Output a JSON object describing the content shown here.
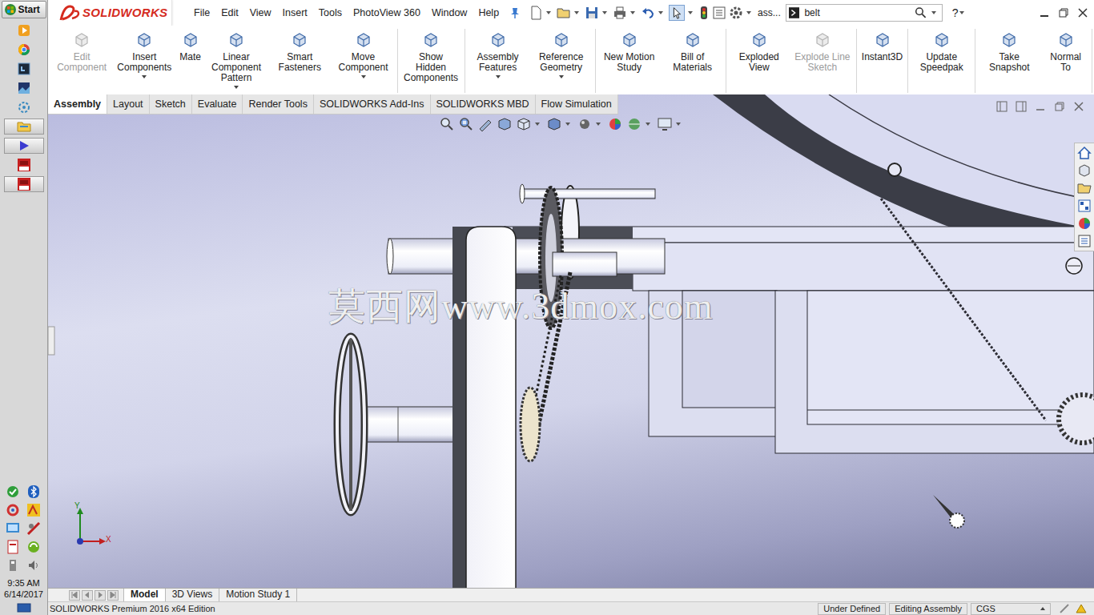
{
  "taskbar": {
    "start": "Start",
    "time": "9:35 AM",
    "date": "6/14/2017"
  },
  "app": {
    "logo": "SOLIDWORKS",
    "menus": [
      "File",
      "Edit",
      "View",
      "Insert",
      "Tools",
      "PhotoView 360",
      "Window",
      "Help"
    ],
    "document": "ass...",
    "search": {
      "value": "belt"
    },
    "help": "?"
  },
  "command_manager": {
    "groups": [
      [
        {
          "label": "Edit Component",
          "disabled": true,
          "dropdown": false
        },
        {
          "label": "Insert Components",
          "disabled": false,
          "dropdown": true
        },
        {
          "label": "Mate",
          "disabled": false,
          "dropdown": false
        },
        {
          "label": "Linear Component Pattern",
          "disabled": false,
          "dropdown": true
        },
        {
          "label": "Smart Fasteners",
          "disabled": false,
          "dropdown": false
        },
        {
          "label": "Move Component",
          "disabled": false,
          "dropdown": true
        }
      ],
      [
        {
          "label": "Show Hidden Components",
          "disabled": false,
          "dropdown": false
        }
      ],
      [
        {
          "label": "Assembly Features",
          "disabled": false,
          "dropdown": true
        },
        {
          "label": "Reference Geometry",
          "disabled": false,
          "dropdown": true
        }
      ],
      [
        {
          "label": "New Motion Study",
          "disabled": false,
          "dropdown": false
        },
        {
          "label": "Bill of Materials",
          "disabled": false,
          "dropdown": false
        }
      ],
      [
        {
          "label": "Exploded View",
          "disabled": false,
          "dropdown": false
        },
        {
          "label": "Explode Line Sketch",
          "disabled": true,
          "dropdown": false
        }
      ],
      [
        {
          "label": "Instant3D",
          "disabled": false,
          "dropdown": false
        }
      ],
      [
        {
          "label": "Update Speedpak",
          "disabled": false,
          "dropdown": false
        }
      ],
      [
        {
          "label": "Take Snapshot",
          "disabled": false,
          "dropdown": false
        },
        {
          "label": "Normal To",
          "disabled": false,
          "dropdown": false
        }
      ]
    ]
  },
  "tabs": [
    {
      "label": "Assembly",
      "selected": true
    },
    {
      "label": "Layout",
      "selected": false
    },
    {
      "label": "Sketch",
      "selected": false
    },
    {
      "label": "Evaluate",
      "selected": false
    },
    {
      "label": "Render Tools",
      "selected": false
    },
    {
      "label": "SOLIDWORKS Add-Ins",
      "selected": false
    },
    {
      "label": "SOLIDWORKS MBD",
      "selected": false
    },
    {
      "label": "Flow Simulation",
      "selected": false
    }
  ],
  "viewport": {
    "watermark": "莫西网www.3dmox.com",
    "axes": {
      "y": "Y",
      "x": "X"
    }
  },
  "bottom_tabs": [
    {
      "label": "Model",
      "selected": true
    },
    {
      "label": "3D Views",
      "selected": false
    },
    {
      "label": "Motion Study 1",
      "selected": false
    }
  ],
  "status_bar": {
    "edition": "SOLIDWORKS Premium 2016 x64 Edition",
    "fields": [
      "Under Defined",
      "Editing Assembly",
      "CGS"
    ]
  }
}
